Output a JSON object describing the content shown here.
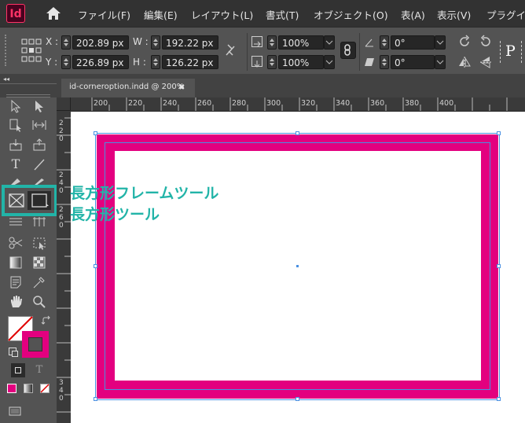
{
  "app": {
    "logo_text": "Id"
  },
  "menu": {
    "items": [
      "ファイル(F)",
      "編集(E)",
      "レイアウト(L)",
      "書式(T)",
      "オブジェクト(O)",
      "表(A)",
      "表示(V)",
      "プラグイ"
    ]
  },
  "control": {
    "x_label": "X :",
    "x_value": "202.89 px",
    "y_label": "Y :",
    "y_value": "226.89 px",
    "w_label": "W :",
    "w_value": "192.22 px",
    "h_label": "H :",
    "h_value": "126.22 px",
    "scale_x": "100%",
    "scale_y": "100%",
    "rotate": "0°",
    "shear": "0°",
    "p_label": "P"
  },
  "document": {
    "tab_title": "id-corneroption.indd @ 200%",
    "close": "✖"
  },
  "ruler": {
    "h_ticks": [
      "200",
      "220",
      "240",
      "260",
      "280",
      "300",
      "320",
      "340",
      "360",
      "380",
      "400"
    ],
    "v_ticks": [
      "2 2 0",
      "2 4 0",
      "2 6 0",
      "3 4 0"
    ]
  },
  "callout": {
    "line1": "長方形フレームツール",
    "line2": "長方形ツール"
  },
  "colors": {
    "accent": "#e3007f",
    "callout": "#22b4a8",
    "selection": "#4a90e2"
  }
}
